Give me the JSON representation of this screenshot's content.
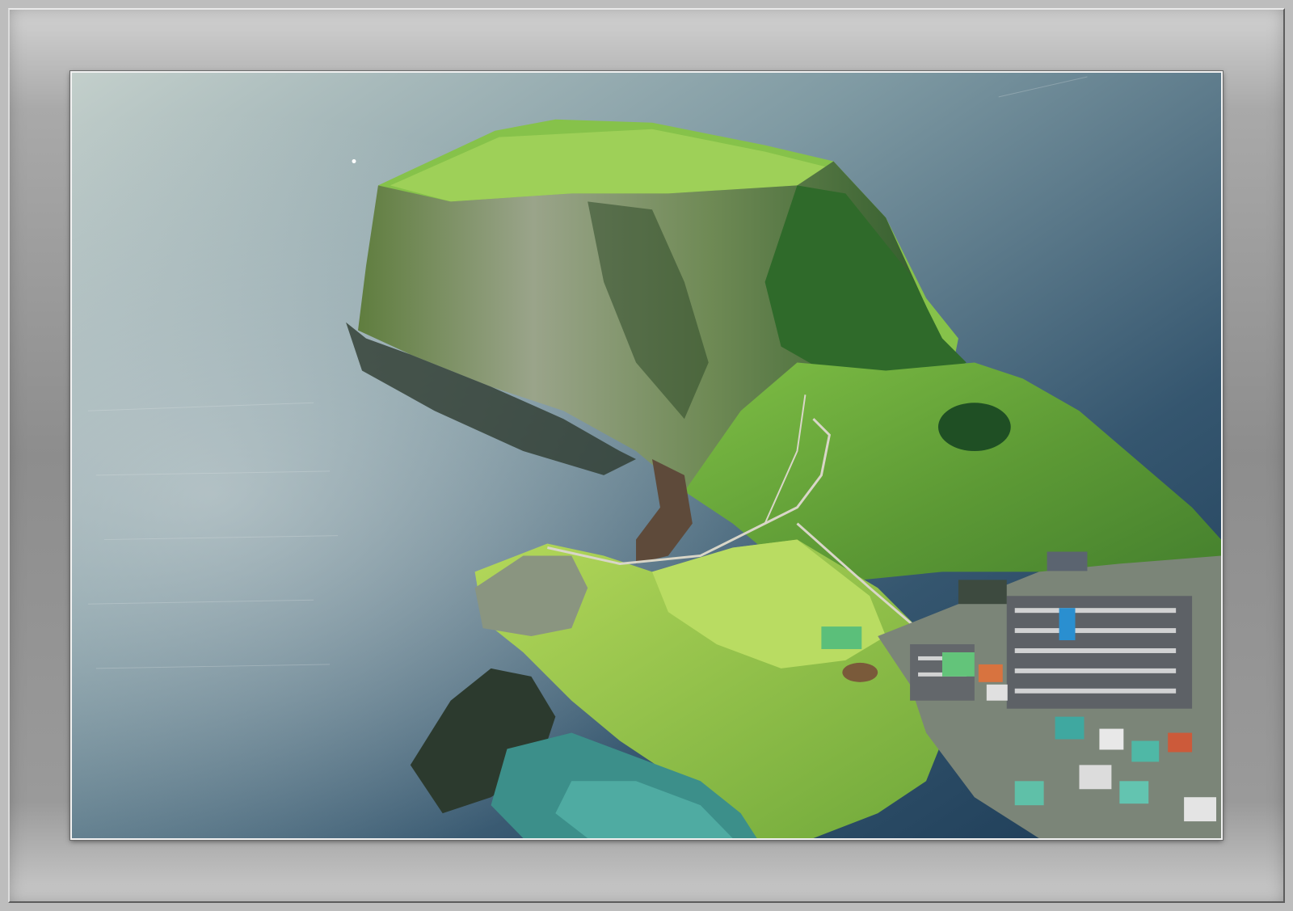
{
  "scene": {
    "subject": "aerial-island-crater",
    "colors": {
      "ocean_light": "#a9b9b8",
      "ocean_deep": "#183650",
      "grass": "#6fae3c",
      "grass_light": "#a7cc52",
      "cliff": "#7c8a6a",
      "lagoon": "#3a8f8c",
      "mat": "#9a9a9a",
      "frame_line": "#f2f2f2"
    }
  }
}
